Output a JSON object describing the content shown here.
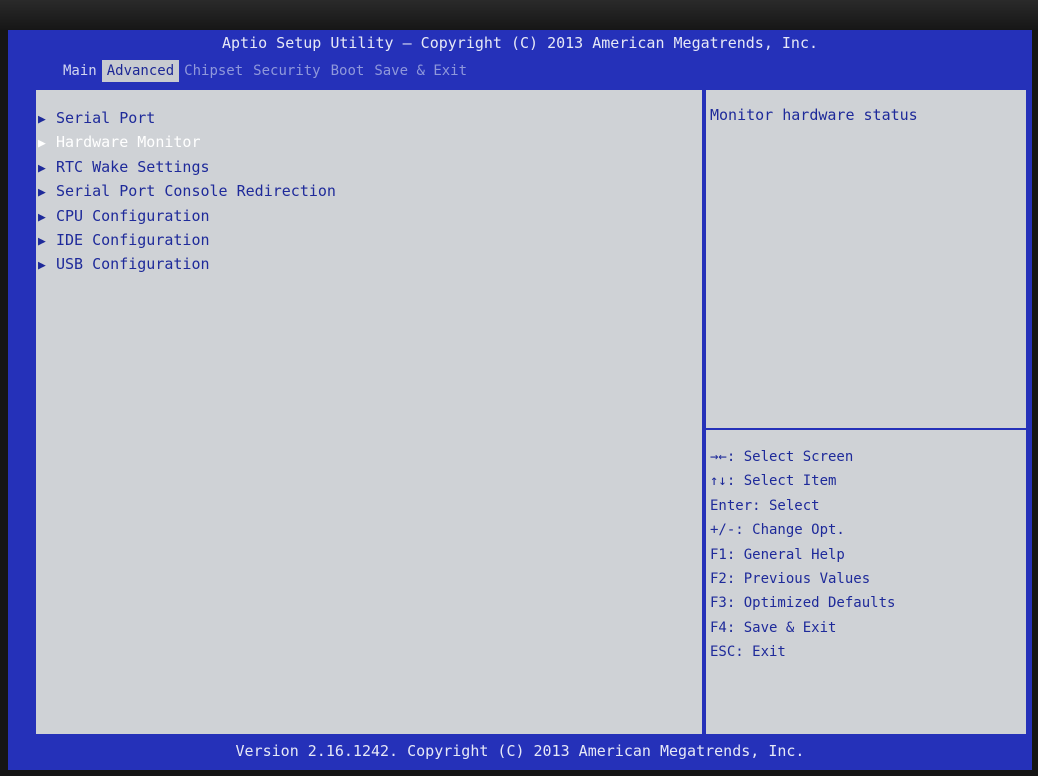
{
  "header": {
    "title": "Aptio Setup Utility – Copyright (C) 2013 American Megatrends, Inc.",
    "tabs": [
      "Main",
      "Advanced",
      "Chipset",
      "Security",
      "Boot",
      "Save & Exit"
    ],
    "active_tab": "Advanced"
  },
  "menu": {
    "arrow_glyph": "▶",
    "items": [
      "Serial Port",
      "Hardware Monitor",
      "RTC Wake Settings",
      "Serial Port Console Redirection",
      "CPU Configuration",
      "IDE Configuration",
      "USB Configuration"
    ],
    "selected": "Hardware Monitor"
  },
  "help": {
    "description": "Monitor hardware status",
    "keys": [
      "→←: Select Screen",
      "↑↓: Select Item",
      "Enter: Select",
      "+/-: Change Opt.",
      "F1: General Help",
      "F2: Previous Values",
      "F3: Optimized Defaults",
      "F4: Save & Exit",
      "ESC: Exit"
    ]
  },
  "footer": {
    "version": "Version 2.16.1242. Copyright (C) 2013 American Megatrends, Inc."
  },
  "colors": {
    "frame_blue": "#2531b9",
    "panel_grey": "#cfd2d6",
    "text_blue": "#1e2a9a",
    "highlight_text": "#ffffff"
  }
}
